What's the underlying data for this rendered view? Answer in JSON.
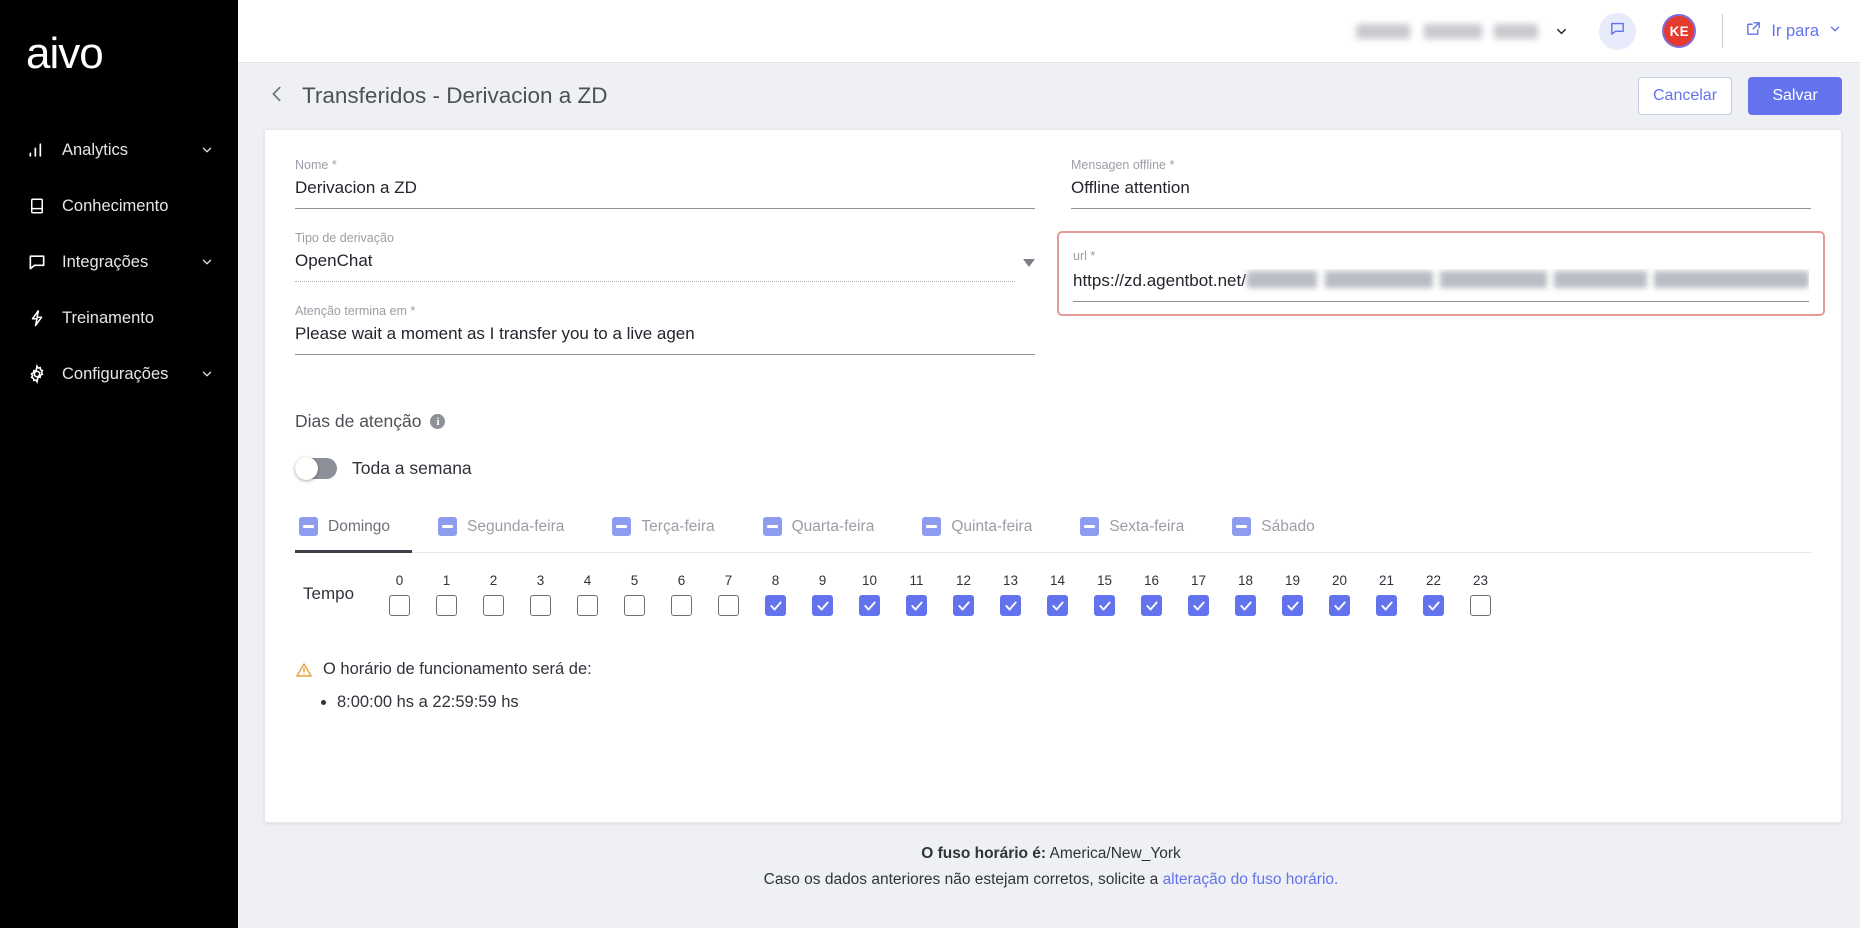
{
  "sidebar": {
    "logo": "aivo",
    "items": [
      {
        "label": "Analytics",
        "icon": "bar-chart-icon",
        "chevron": true
      },
      {
        "label": "Conhecimento",
        "icon": "book-icon",
        "chevron": false
      },
      {
        "label": "Integrações",
        "icon": "chat-bubble-icon",
        "chevron": true
      },
      {
        "label": "Treinamento",
        "icon": "lightning-bolt-icon",
        "chevron": false
      },
      {
        "label": "Configurações",
        "icon": "gear-icon",
        "chevron": true
      }
    ]
  },
  "topbar": {
    "account_name": "",
    "chat_icon": "chat-bubble-icon",
    "avatar_initials": "KE",
    "avatar_color": "#e73a2e",
    "goto_label": "Ir para",
    "goto_icon": "external-link-icon"
  },
  "page": {
    "back_icon": "chevron-left-icon",
    "title": "Transferidos - Derivacion a ZD",
    "cancel_label": "Cancelar",
    "save_label": "Salvar",
    "accent_color": "#6373ee",
    "highlight_border_color": "#e49a98"
  },
  "form": {
    "nome": {
      "label": "Nome *",
      "value": "Derivacion a ZD"
    },
    "tipo": {
      "label": "Tipo de derivação",
      "value": "OpenChat"
    },
    "atencao": {
      "label": "Atenção termina em *",
      "value": "Please wait a moment as I transfer you to a live agen"
    },
    "mensagem_offline": {
      "label": "Mensagen offline *",
      "value": "Offline attention"
    },
    "url": {
      "label": "url *",
      "value": "https://zd.agentbot.net/"
    }
  },
  "schedule": {
    "section_title": "Dias de atenção",
    "info_icon": "info-icon",
    "toggle_label": "Toda a semana",
    "toggle_on": false,
    "days": [
      {
        "label": "Domingo",
        "active": true,
        "state": "indeterminate"
      },
      {
        "label": "Segunda-feira",
        "active": false,
        "state": "indeterminate"
      },
      {
        "label": "Terça-feira",
        "active": false,
        "state": "indeterminate"
      },
      {
        "label": "Quarta-feira",
        "active": false,
        "state": "indeterminate"
      },
      {
        "label": "Quinta-feira",
        "active": false,
        "state": "indeterminate"
      },
      {
        "label": "Sexta-feira",
        "active": false,
        "state": "indeterminate"
      },
      {
        "label": "Sábado",
        "active": false,
        "state": "indeterminate"
      }
    ],
    "tempo_label": "Tempo",
    "hours": [
      {
        "hour": "0",
        "checked": false
      },
      {
        "hour": "1",
        "checked": false
      },
      {
        "hour": "2",
        "checked": false
      },
      {
        "hour": "3",
        "checked": false
      },
      {
        "hour": "4",
        "checked": false
      },
      {
        "hour": "5",
        "checked": false
      },
      {
        "hour": "6",
        "checked": false
      },
      {
        "hour": "7",
        "checked": false
      },
      {
        "hour": "8",
        "checked": true
      },
      {
        "hour": "9",
        "checked": true
      },
      {
        "hour": "10",
        "checked": true
      },
      {
        "hour": "11",
        "checked": true
      },
      {
        "hour": "12",
        "checked": true
      },
      {
        "hour": "13",
        "checked": true
      },
      {
        "hour": "14",
        "checked": true
      },
      {
        "hour": "15",
        "checked": true
      },
      {
        "hour": "16",
        "checked": true
      },
      {
        "hour": "17",
        "checked": true
      },
      {
        "hour": "18",
        "checked": true
      },
      {
        "hour": "19",
        "checked": true
      },
      {
        "hour": "20",
        "checked": true
      },
      {
        "hour": "21",
        "checked": true
      },
      {
        "hour": "22",
        "checked": true
      },
      {
        "hour": "23",
        "checked": false
      }
    ],
    "warning_icon": "warning-triangle-icon",
    "warning_text": "O horário de funcionamento será de:",
    "warning_items": [
      "8:00:00 hs a 22:59:59 hs"
    ]
  },
  "footer": {
    "timezone_label": "O fuso horário é:",
    "timezone_value": "America/New_York",
    "note_prefix": "Caso os dados anteriores não estejam corretos, solicite a ",
    "note_link": "alteração do fuso horário."
  }
}
